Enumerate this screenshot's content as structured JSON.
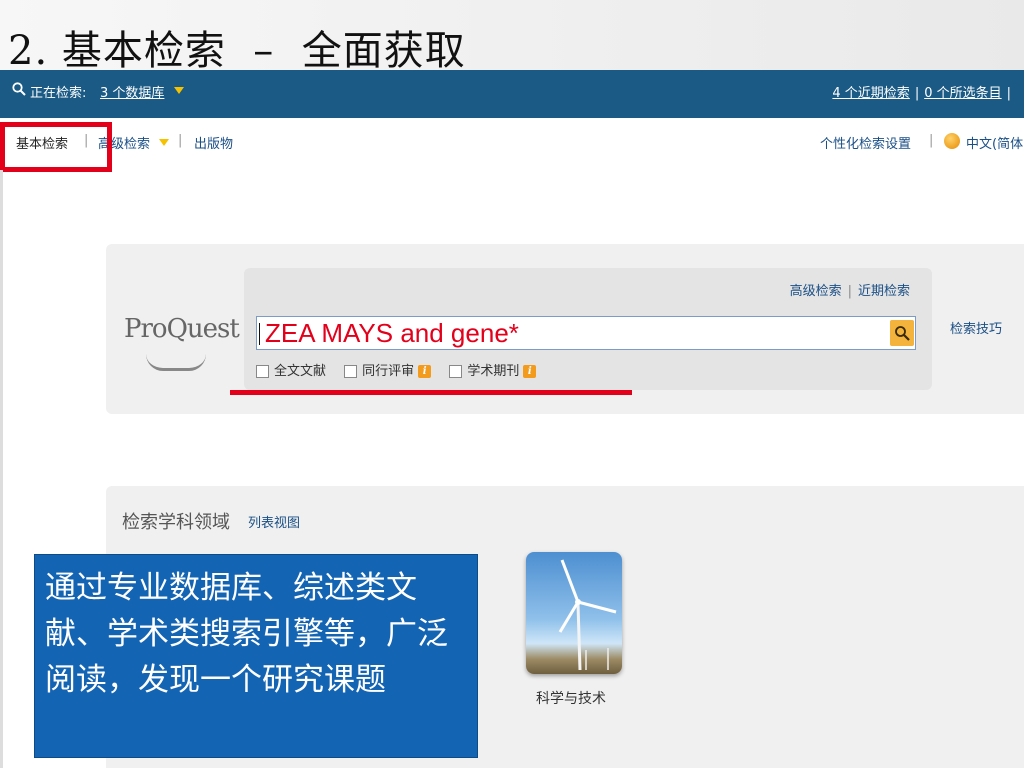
{
  "slide": {
    "title": "2. 基本检索  –  全面获取"
  },
  "topbar": {
    "searching_label": "正在检索:",
    "databases_link": "3 个数据库",
    "recent_searches": "4 个近期检索",
    "selected_items": "0 个所选条目"
  },
  "subnav": {
    "basic_search": "基本检索",
    "advanced_search": "高级检索",
    "publications": "出版物",
    "settings": "个性化检索设置",
    "language": "中文(简体"
  },
  "search": {
    "logo": "ProQuest",
    "advanced_link": "高级检索",
    "recent_link": "近期检索",
    "query": "ZEA MAYS and gene*",
    "tips": "检索技巧",
    "filters": [
      {
        "label": "全文文献",
        "checked": false,
        "info": false
      },
      {
        "label": "同行评审",
        "checked": false,
        "info": true
      },
      {
        "label": "学术期刊",
        "checked": false,
        "info": true
      }
    ]
  },
  "subjects": {
    "title": "检索学科领域",
    "list_view": "列表视图",
    "tiles": [
      {
        "label": "科学与技术"
      }
    ]
  },
  "callout": {
    "text": "通过专业数据库、综述类文献、学术类搜索引擎等，广泛阅读，发现一个研究课题"
  },
  "colors": {
    "topbar": "#1a5a85",
    "highlight": "#e3001b",
    "callout": "#1464b4",
    "link": "#1a4f86"
  }
}
